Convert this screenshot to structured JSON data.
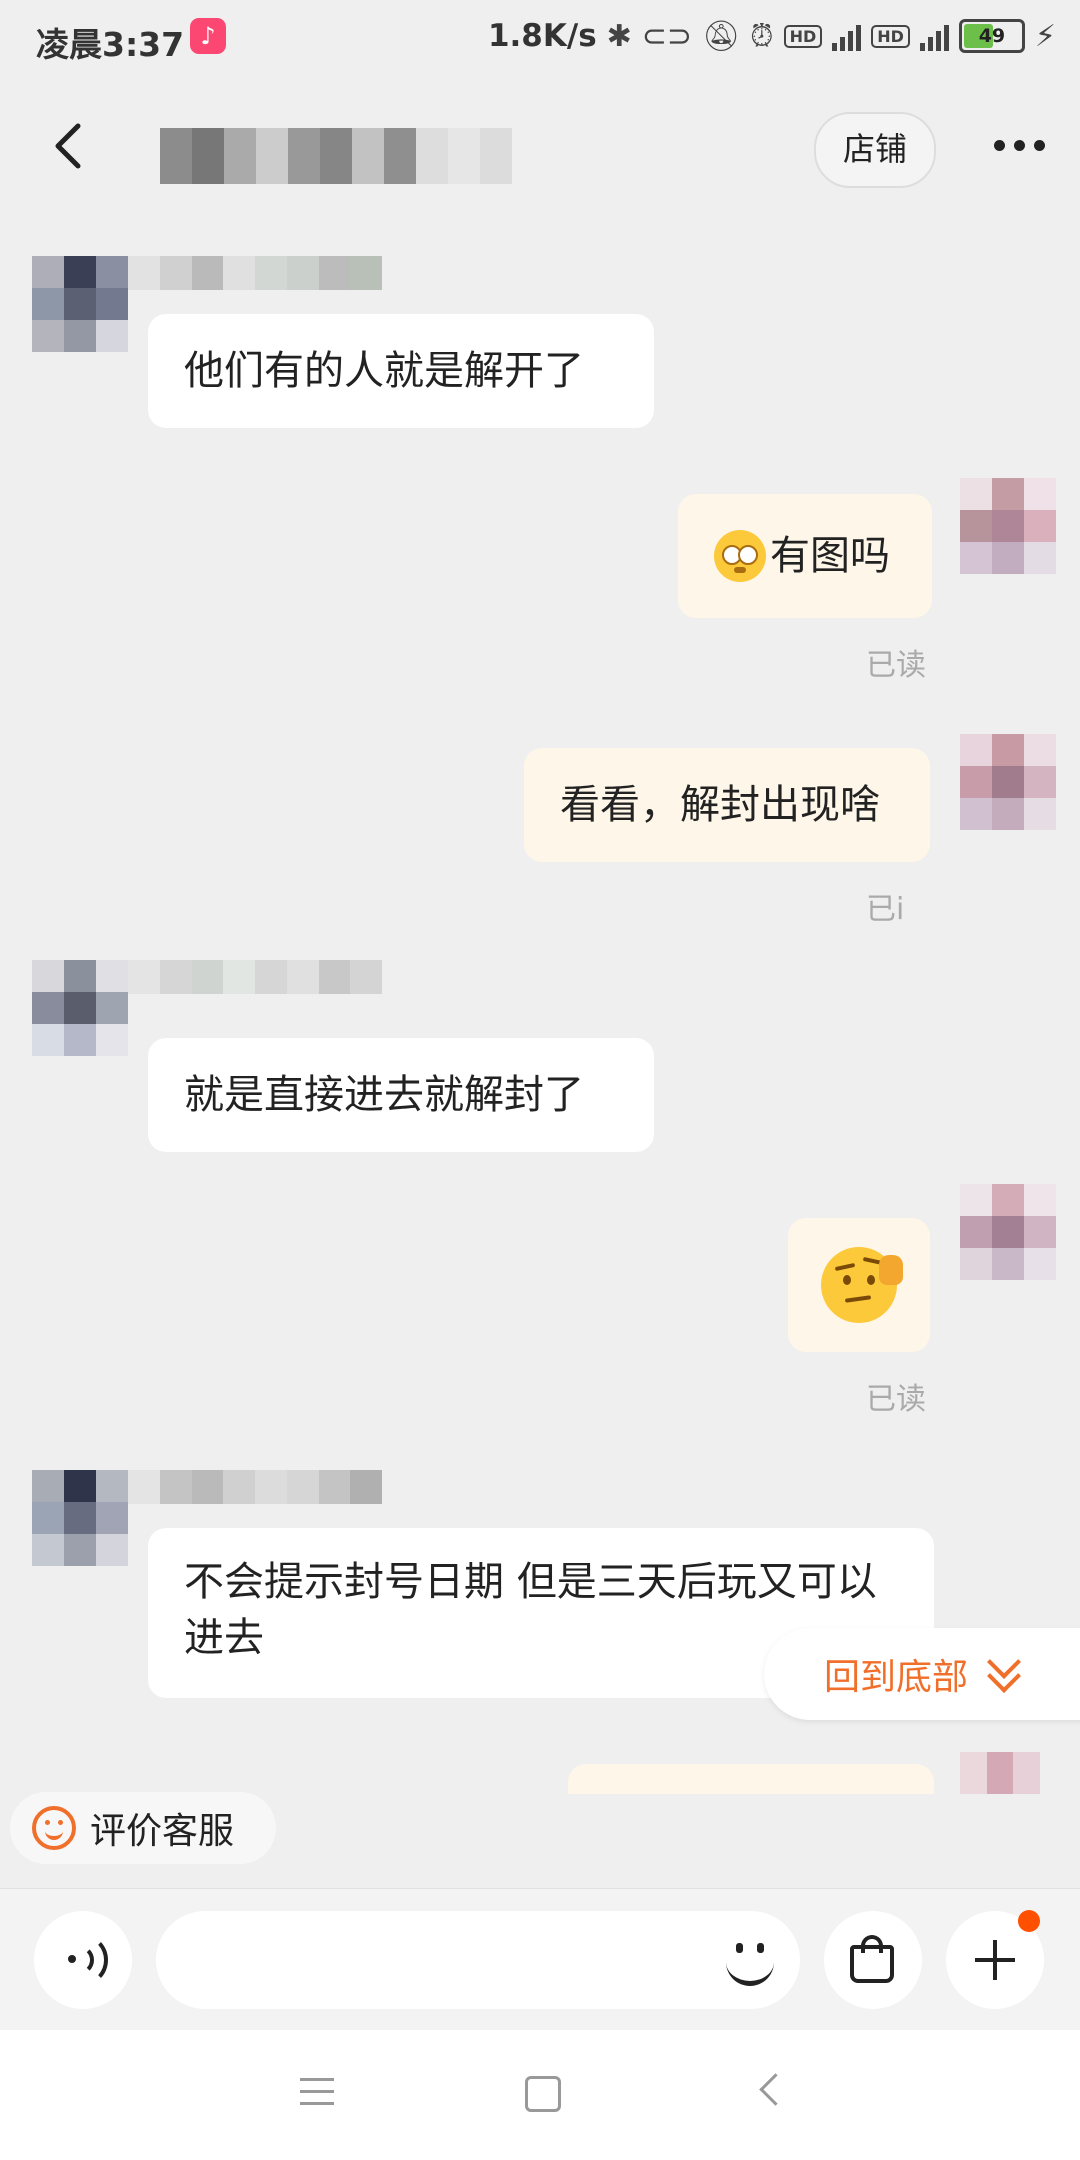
{
  "status_bar": {
    "time": "凌晨3:37",
    "app_badge_icon": "douyin-icon",
    "net_speed": "1.8K/s",
    "hd": "HD",
    "net_type": "4G",
    "battery": "49"
  },
  "header": {
    "store_label": "店铺"
  },
  "messages": [
    {
      "side": "left",
      "text": "他们有的人就是解开了"
    },
    {
      "side": "right",
      "text": "有图吗",
      "emoji": "rolling-eyes-emoji",
      "read": "已读"
    },
    {
      "side": "right",
      "text": "看看，解封出现啥",
      "read": "已i"
    },
    {
      "side": "left",
      "text": "就是直接进去就解封了"
    },
    {
      "side": "right",
      "emoji": "thinking-face-emoji",
      "read": "已读"
    },
    {
      "side": "left",
      "text": "不会提示封号日期 但是三天后玩又可以进去"
    }
  ],
  "back_to_bottom": "回到底部",
  "rate_service": "评价客服",
  "input": {
    "placeholder": ""
  },
  "colors": {
    "accent": "#f0702b",
    "left_bubble": "#ffffff",
    "right_bubble": "#fef6e9",
    "background": "#efefef",
    "notification": "#ff5000"
  }
}
